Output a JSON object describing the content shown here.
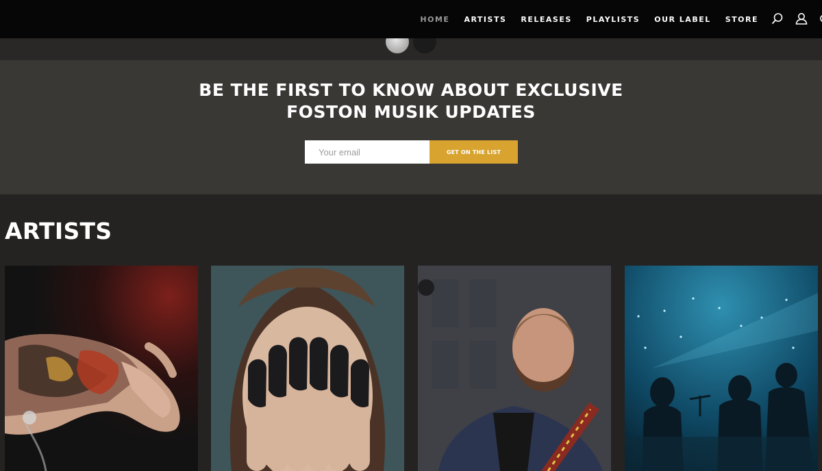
{
  "nav": {
    "items": [
      {
        "label": "HOME",
        "active": true
      },
      {
        "label": "ARTISTS",
        "active": false
      },
      {
        "label": "RELEASES",
        "active": false
      },
      {
        "label": "PLAYLISTS",
        "active": false
      },
      {
        "label": "OUR LABEL",
        "active": false
      },
      {
        "label": "STORE",
        "active": false
      }
    ],
    "icons": [
      "search-icon",
      "user-icon"
    ]
  },
  "slider": {
    "dots": 2,
    "active_index": 0
  },
  "newsletter": {
    "title_line1": "BE THE FIRST TO KNOW ABOUT EXCLUSIVE",
    "title_line2": "FOSTON MUSIK UPDATES",
    "email_placeholder": "Your email",
    "email_value": "",
    "button_label": "GET ON THE LIST"
  },
  "artists": {
    "title": "ARTISTS",
    "cards": [
      {
        "image": "tattooed-hand-photo"
      },
      {
        "image": "covered-face-photo"
      },
      {
        "image": "bearded-guitarist-photo"
      },
      {
        "image": "band-on-stage-photo"
      }
    ]
  },
  "colors": {
    "nav_bg": "#060606",
    "newsletter_bg": "#3a3835",
    "page_bg": "#242322",
    "accent": "#d8a32f"
  }
}
